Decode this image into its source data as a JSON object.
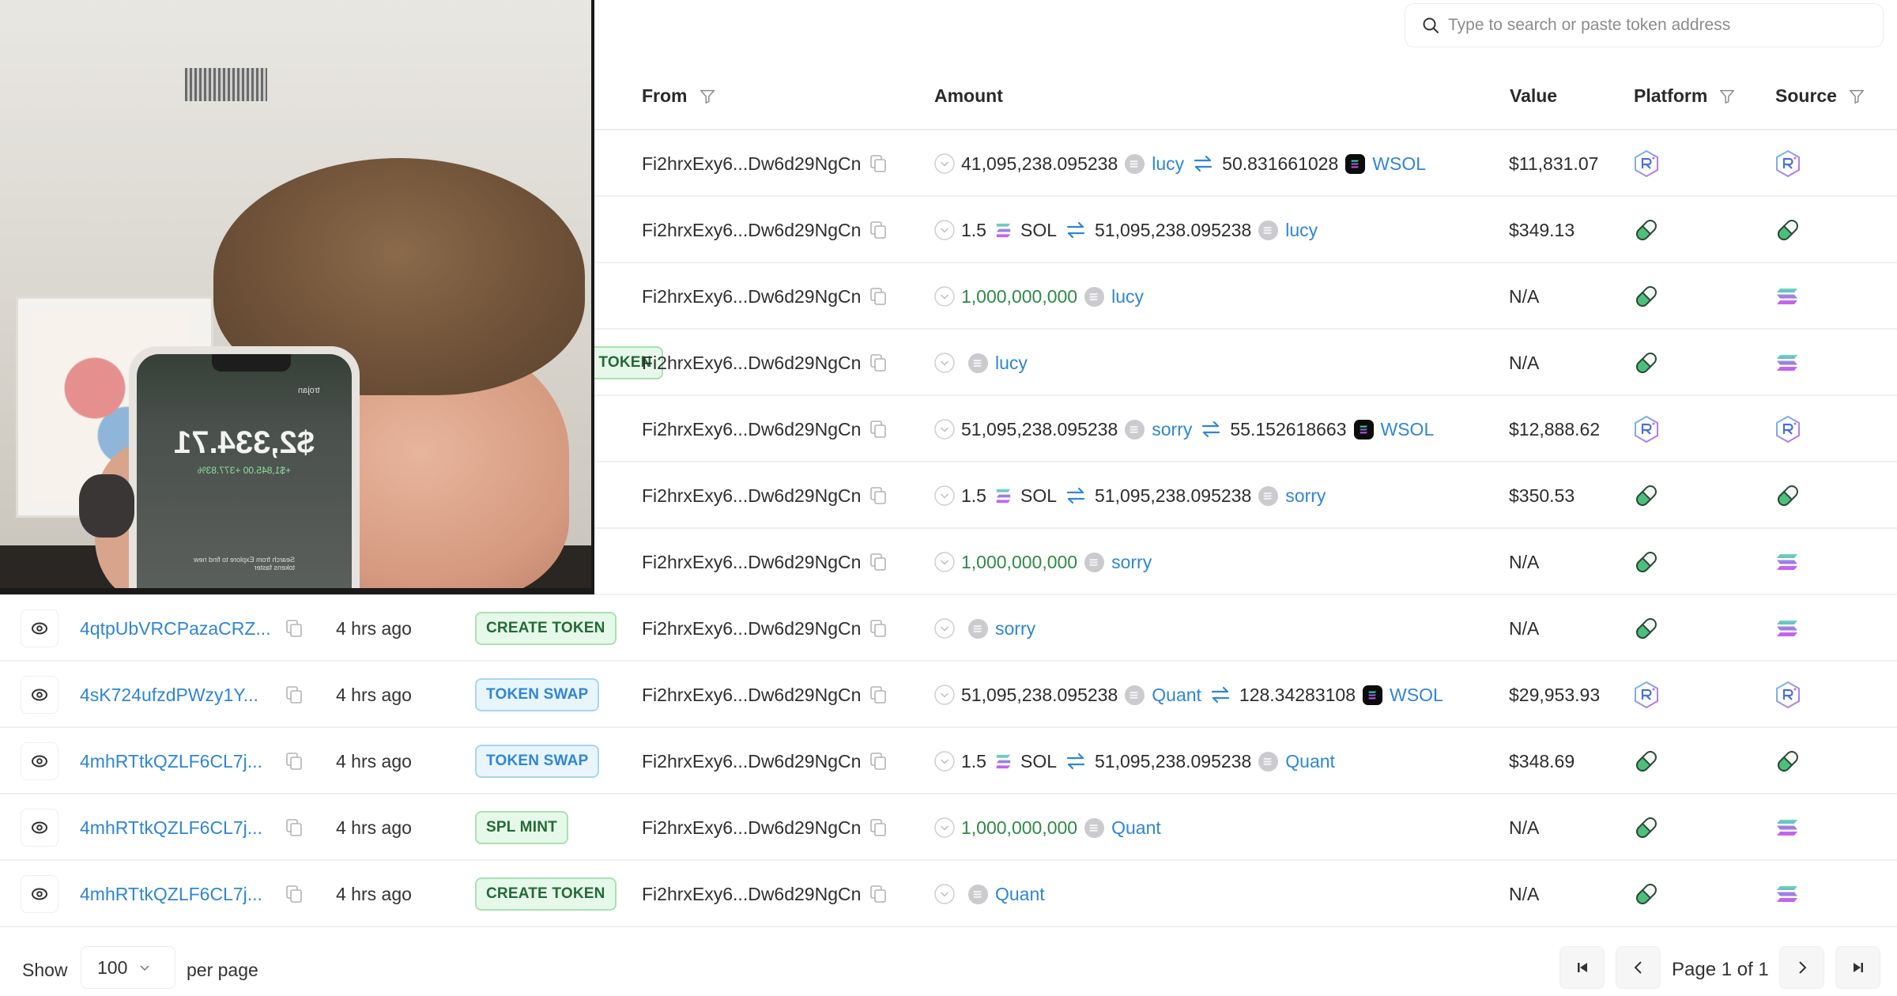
{
  "search": {
    "placeholder": "Type to search or paste token address"
  },
  "table": {
    "columns": {
      "from": "From",
      "amount": "Amount",
      "value": "Value",
      "platform": "Platform",
      "source": "Source"
    },
    "rows": [
      {
        "signature": "",
        "age": "",
        "type": "",
        "type_color": "",
        "from": "Fi2hrxExy6...Dw6d29NgCn",
        "amount": {
          "kind": "swap",
          "in_amount": "41,095,238.095238",
          "in_token": "lucy",
          "in_icon": "generic-token",
          "out_amount": "50.831661028",
          "out_token": "WSOL",
          "out_icon": "wsol-token"
        },
        "value": "$11,831.07",
        "platform": "raydium",
        "source": "raydium"
      },
      {
        "signature": "",
        "age": "",
        "type": "",
        "type_color": "",
        "from": "Fi2hrxExy6...Dw6d29NgCn",
        "amount": {
          "kind": "swap",
          "in_amount": "1.5",
          "in_token": "SOL",
          "in_icon": "sol-token",
          "out_amount": "51,095,238.095238",
          "out_token": "lucy",
          "out_icon": "generic-token"
        },
        "value": "$349.13",
        "platform": "pump",
        "source": "pump"
      },
      {
        "signature": "",
        "age": "",
        "type": "",
        "type_color": "",
        "from": "Fi2hrxExy6...Dw6d29NgCn",
        "amount": {
          "kind": "mint",
          "in_amount": "1,000,000,000",
          "in_token": "lucy",
          "in_icon": "generic-token"
        },
        "value": "N/A",
        "platform": "pump",
        "source": "solana"
      },
      {
        "signature": "",
        "age": "",
        "type": "CREATE TOKEN",
        "type_color": "green",
        "type_partial": true,
        "from": "Fi2hrxExy6...Dw6d29NgCn",
        "amount": {
          "kind": "create",
          "in_token": "lucy",
          "in_icon": "generic-token"
        },
        "value": "N/A",
        "platform": "pump",
        "source": "solana"
      },
      {
        "signature": "",
        "age": "",
        "type": "",
        "type_color": "",
        "from": "Fi2hrxExy6...Dw6d29NgCn",
        "amount": {
          "kind": "swap",
          "in_amount": "51,095,238.095238",
          "in_token": "sorry",
          "in_icon": "generic-token",
          "out_amount": "55.152618663",
          "out_token": "WSOL",
          "out_icon": "wsol-token"
        },
        "value": "$12,888.62",
        "platform": "raydium",
        "source": "raydium"
      },
      {
        "signature": "",
        "age": "",
        "type": "",
        "type_color": "",
        "from": "Fi2hrxExy6...Dw6d29NgCn",
        "amount": {
          "kind": "swap",
          "in_amount": "1.5",
          "in_token": "SOL",
          "in_icon": "sol-token",
          "out_amount": "51,095,238.095238",
          "out_token": "sorry",
          "out_icon": "generic-token"
        },
        "value": "$350.53",
        "platform": "pump",
        "source": "pump"
      },
      {
        "signature": "",
        "age": "",
        "type": "",
        "type_color": "",
        "from": "Fi2hrxExy6...Dw6d29NgCn",
        "amount": {
          "kind": "mint",
          "in_amount": "1,000,000,000",
          "in_token": "sorry",
          "in_icon": "generic-token"
        },
        "value": "N/A",
        "platform": "pump",
        "source": "solana"
      },
      {
        "signature": "4qtpUbVRCPazaCRZ...",
        "age": "4 hrs ago",
        "type": "CREATE TOKEN",
        "type_color": "green",
        "from": "Fi2hrxExy6...Dw6d29NgCn",
        "amount": {
          "kind": "create",
          "in_token": "sorry",
          "in_icon": "generic-token"
        },
        "value": "N/A",
        "platform": "pump",
        "source": "solana"
      },
      {
        "signature": "4sK724ufzdPWzy1Y...",
        "age": "4 hrs ago",
        "type": "TOKEN SWAP",
        "type_color": "blue",
        "from": "Fi2hrxExy6...Dw6d29NgCn",
        "amount": {
          "kind": "swap",
          "in_amount": "51,095,238.095238",
          "in_token": "Quant",
          "in_icon": "generic-token",
          "out_amount": "128.34283108",
          "out_token": "WSOL",
          "out_icon": "wsol-token"
        },
        "value": "$29,953.93",
        "platform": "raydium",
        "source": "raydium"
      },
      {
        "signature": "4mhRTtkQZLF6CL7j...",
        "age": "4 hrs ago",
        "type": "TOKEN SWAP",
        "type_color": "blue",
        "from": "Fi2hrxExy6...Dw6d29NgCn",
        "amount": {
          "kind": "swap",
          "in_amount": "1.5",
          "in_token": "SOL",
          "in_icon": "sol-token",
          "out_amount": "51,095,238.095238",
          "out_token": "Quant",
          "out_icon": "generic-token"
        },
        "value": "$348.69",
        "platform": "pump",
        "source": "pump"
      },
      {
        "signature": "4mhRTtkQZLF6CL7j...",
        "age": "4 hrs ago",
        "type": "SPL MINT",
        "type_color": "green",
        "from": "Fi2hrxExy6...Dw6d29NgCn",
        "amount": {
          "kind": "mint",
          "in_amount": "1,000,000,000",
          "in_token": "Quant",
          "in_icon": "generic-token"
        },
        "value": "N/A",
        "platform": "pump",
        "source": "solana"
      },
      {
        "signature": "4mhRTtkQZLF6CL7j...",
        "age": "4 hrs ago",
        "type": "CREATE TOKEN",
        "type_color": "green",
        "from": "Fi2hrxExy6...Dw6d29NgCn",
        "amount": {
          "kind": "create",
          "in_token": "Quant",
          "in_icon": "generic-token"
        },
        "value": "N/A",
        "platform": "pump",
        "source": "solana"
      }
    ]
  },
  "footer": {
    "show_label": "Show",
    "per_page_value": "100",
    "per_page_label": "per page",
    "page_text": "Page 1 of 1"
  },
  "webcam": {
    "phone_balance": "$2,334.71",
    "phone_change": "+$1,845.00  +377.83%",
    "phone_account": "trojan",
    "phone_hint": "Search from Explore to find new tokens faster"
  },
  "colors": {
    "link": "#2f86d6",
    "mint_green": "#2e8a45",
    "badge_green_bg": "#e6f8e9",
    "badge_blue_bg": "#e8f5fd"
  }
}
